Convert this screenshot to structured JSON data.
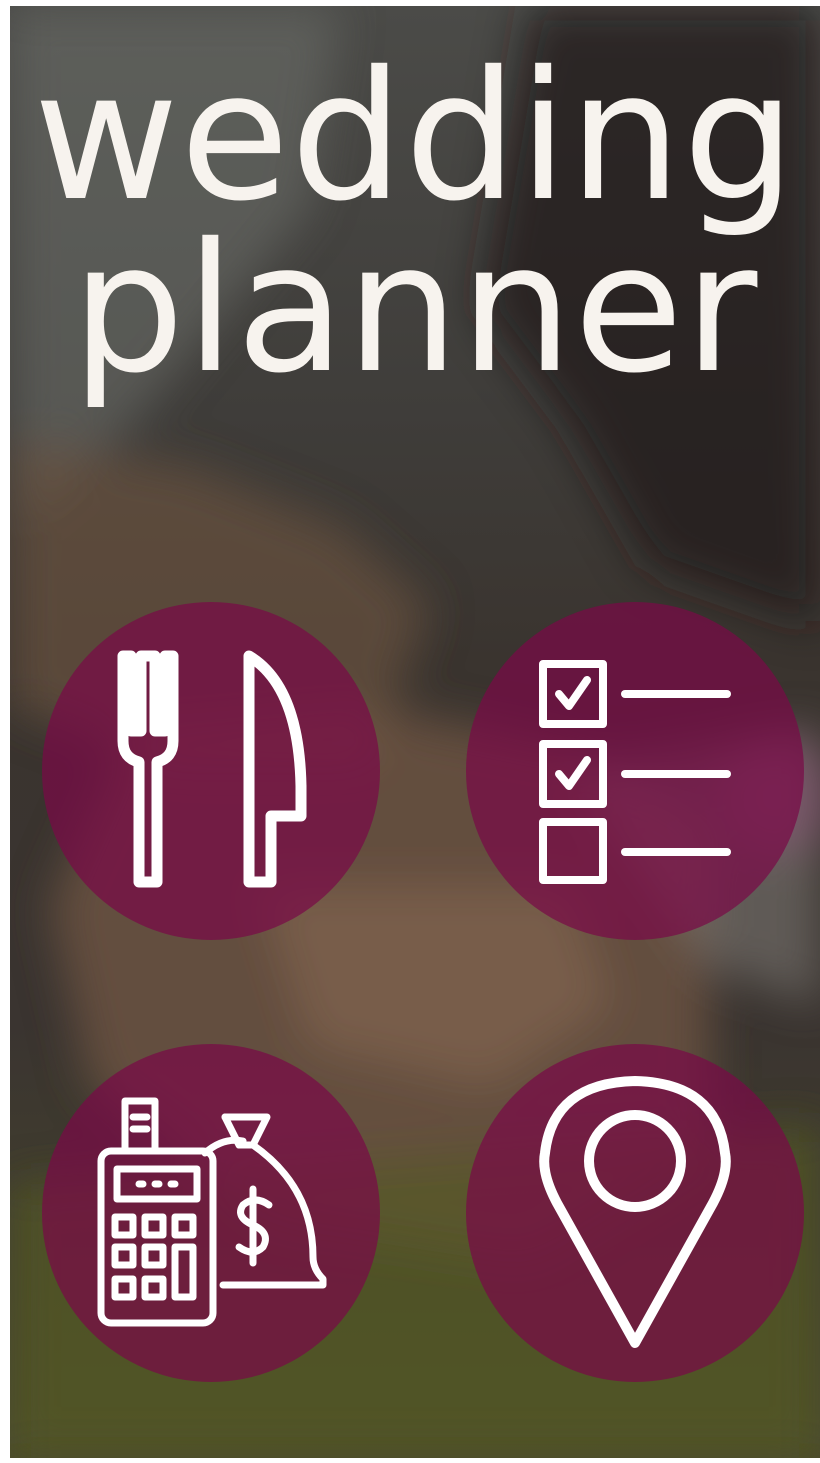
{
  "app": {
    "title_line_1": "wedding",
    "title_line_2": "planner"
  },
  "colors": {
    "tile_fill": "#780a46",
    "icon_stroke": "#ffffff",
    "title_text": "#f7f3ee"
  },
  "tiles": [
    {
      "id": "dining",
      "icon": "fork-knife-icon"
    },
    {
      "id": "checklist",
      "icon": "checklist-icon"
    },
    {
      "id": "budget",
      "icon": "calculator-money-bag-icon"
    },
    {
      "id": "venue",
      "icon": "location-pin-icon"
    }
  ]
}
